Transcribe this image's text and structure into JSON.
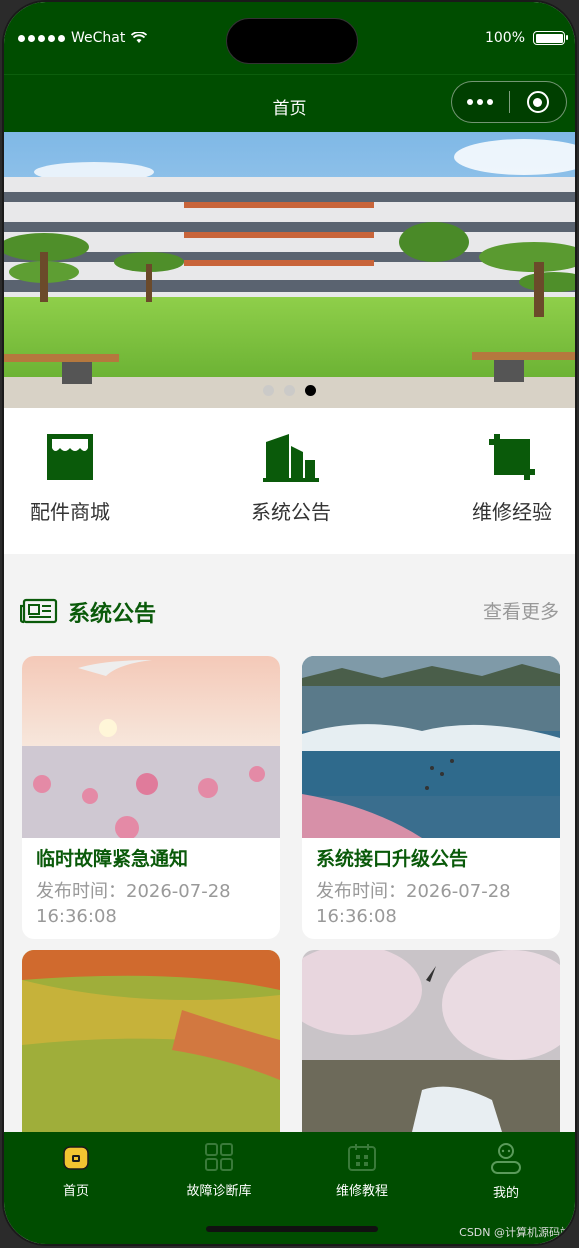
{
  "status": {
    "carrier": "WeChat",
    "battery": "100%"
  },
  "navbar": {
    "title": "首页"
  },
  "banner": {
    "slide_count": 3,
    "active_slide": 3
  },
  "quick_links": [
    {
      "label": "配件商城",
      "icon": "shop-icon"
    },
    {
      "label": "系统公告",
      "icon": "building-icon"
    },
    {
      "label": "维修经验",
      "icon": "crop-icon"
    }
  ],
  "section": {
    "title": "系统公告",
    "more": "查看更多",
    "icon": "newspaper-icon"
  },
  "cards": [
    {
      "title": "临时故障紧急通知",
      "time": "发布时间：2026-07-28 16:36:08"
    },
    {
      "title": "系统接口升级公告",
      "time": "发布时间：2026-07-28 16:36:08"
    },
    {
      "title": "",
      "time": ""
    },
    {
      "title": "",
      "time": ""
    }
  ],
  "tabbar": [
    {
      "label": "首页",
      "icon": "home-icon",
      "active": true
    },
    {
      "label": "故障诊断库",
      "icon": "grid-icon"
    },
    {
      "label": "维修教程",
      "icon": "calendar-icon"
    },
    {
      "label": "我的",
      "icon": "user-icon"
    }
  ],
  "watermark": "CSDN @计算机源码站",
  "colors": {
    "brand": "#004d00",
    "accent_text": "#0a5a0a",
    "muted": "#999999"
  }
}
